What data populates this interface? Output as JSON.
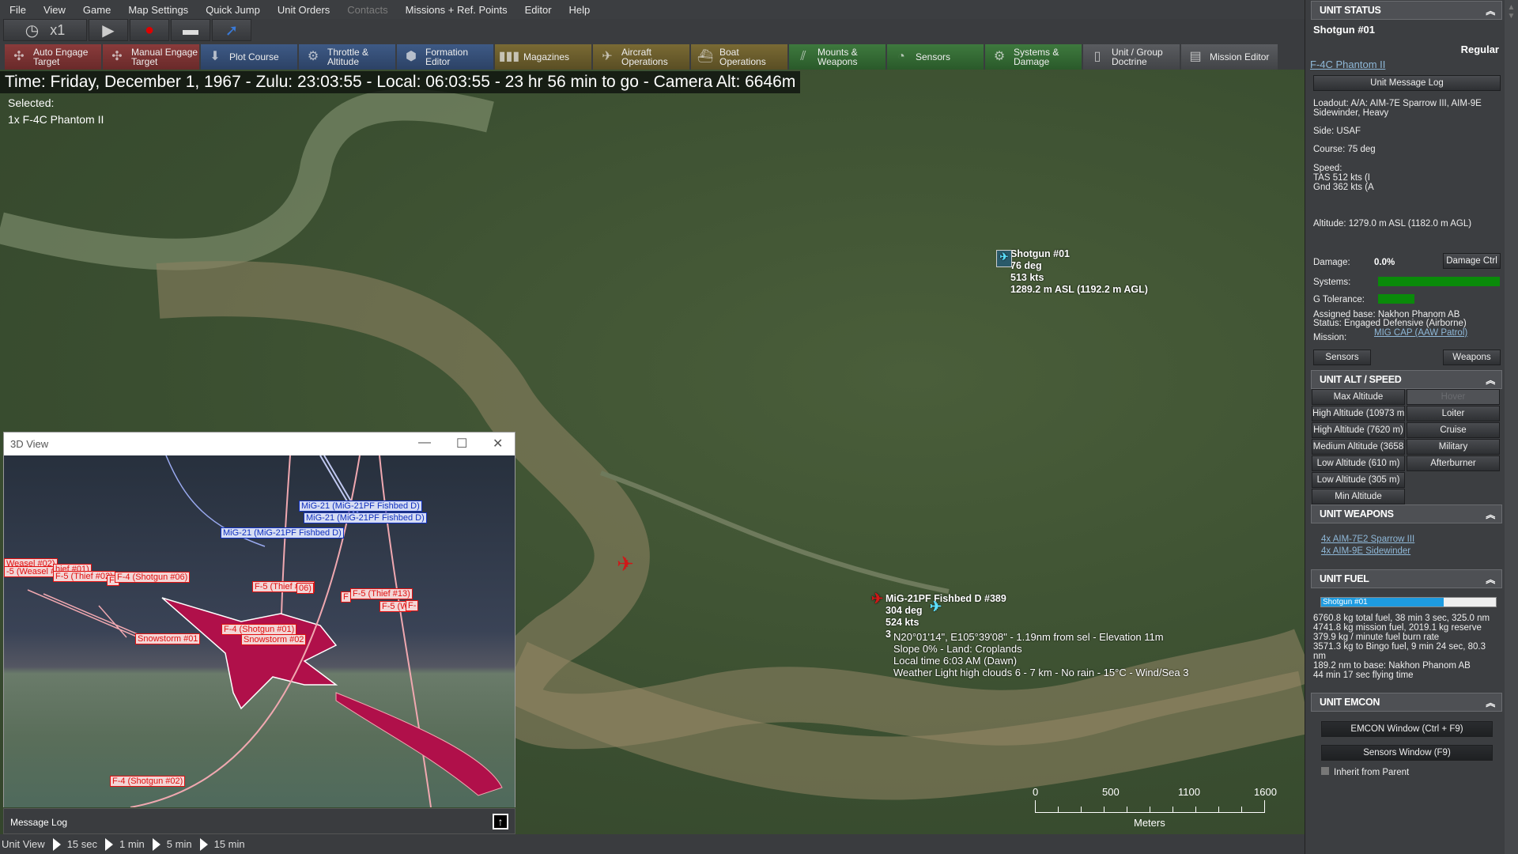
{
  "menu": [
    "File",
    "View",
    "Game",
    "Map Settings",
    "Quick Jump",
    "Unit Orders",
    "Contacts",
    "Missions + Ref. Points",
    "Editor",
    "Help"
  ],
  "menu_disabled": "Contacts",
  "time_control": {
    "speed": "x1"
  },
  "toolbar": [
    {
      "label": "Auto Engage Target",
      "color": "red",
      "icon": "crosshair-arrows-icon"
    },
    {
      "label": "Manual Engage Target",
      "color": "red",
      "icon": "crosshair-arrows-icon"
    },
    {
      "label": "Plot Course",
      "color": "blue",
      "icon": "course-icon"
    },
    {
      "label": "Throttle & Altitude",
      "color": "blue",
      "icon": "throttle-icon"
    },
    {
      "label": "Formation Editor",
      "color": "blue",
      "icon": "formation-icon"
    },
    {
      "label": "Magazines",
      "color": "olive",
      "icon": "ammo-icon"
    },
    {
      "label": "Aircraft Operations",
      "color": "olive",
      "icon": "aircraft-icon"
    },
    {
      "label": "Boat Operations",
      "color": "olive",
      "icon": "boat-icon"
    },
    {
      "label": "Mounts & Weapons",
      "color": "green",
      "icon": "weapons-icon"
    },
    {
      "label": "Sensors",
      "color": "green",
      "icon": "radar-icon"
    },
    {
      "label": "Systems & Damage",
      "color": "green",
      "icon": "gear-icon"
    },
    {
      "label": "Unit / Group Doctrine",
      "color": "gray",
      "icon": "doctrine-icon"
    },
    {
      "label": "Mission Editor",
      "color": "gray",
      "icon": "mission-icon"
    }
  ],
  "timebar": "Time: Friday, December 1, 1967 - Zulu: 23:03:55 - Local: 06:03:55 - 23 hr 56 min to go -  Camera Alt: 6646m",
  "selected": {
    "label": "Selected:",
    "value": "1x F-4C Phantom II"
  },
  "map": {
    "unit": {
      "name": "Shotgun #01",
      "course": "76 deg",
      "speed": "513 kts",
      "alt": "1289.2 m ASL (1192.2 m AGL)"
    },
    "contact": {
      "name": "MiG-21PF Fishbed D #389",
      "course": "304 deg",
      "speed": "524 kts",
      "alt": "3"
    },
    "cursor_info": [
      "N20°01'14\", E105°39'08\" - 1.19nm from sel - Elevation 11m",
      "Slope 0%  - Land: Croplands",
      "Local time 6:03 AM (Dawn)",
      "Weather Light high clouds 6 - 7 km - No rain - 15°C - Wind/Sea 3"
    ],
    "scale": {
      "ticks": [
        "0",
        "500",
        "1100",
        "1600"
      ],
      "unit": "Meters"
    }
  },
  "view3d": {
    "title": "3D View",
    "labels_blue": [
      "MiG-21 (MiG-21PF Fishbed D)",
      "MiG-21 (MiG-21PF Fishbed D)",
      "MiG-21 (MiG-21PF Fishbed D)"
    ],
    "labels_red": [
      "Weasel #02)",
      "-5 (Weasel #01)",
      "hief #01)",
      "F-5 (Thief #02)",
      "F-",
      "F-4 (Shotgun #06)",
      "F-5 (Thief #05)",
      "06)",
      "F",
      "F-5 (Thief #13)",
      "F-5 (W",
      "F-",
      "F-4 (Shotgun #01)",
      "Snowstorm #01",
      "Snowstorm #02",
      "F-4 (Shotgun #02)"
    ]
  },
  "message_log": "Message Log",
  "bottom": {
    "label": "Unit View",
    "steps": [
      "15 sec",
      "1 min",
      "5 min",
      "15 min"
    ]
  },
  "panel": {
    "status": {
      "header": "UNIT STATUS",
      "name": "Shotgun #01",
      "proficiency": "Regular",
      "type": "F-4C Phantom II",
      "msglog_btn": "Unit Message Log",
      "loadout": "Loadout: A/A: AIM-7E Sparrow III, AIM-9E Sidewinder, Heavy",
      "side": "Side: USAF",
      "course": "Course: 75 deg",
      "speed_label": "Speed:",
      "tas": "TAS 512 kts (I",
      "gnd": "Gnd 362 kts (A",
      "altitude": "Altitude: 1279.0 m ASL (1182.0 m AGL)",
      "damage_label": "Damage:",
      "damage": "0.0%",
      "damage_btn": "Damage Ctrl",
      "systems_label": "Systems:",
      "systems_pct": 100,
      "g_label": "G Tolerance:",
      "g_pct": 30,
      "base": "Assigned base: Nakhon Phanom AB",
      "status": "Status: Engaged Defensive (Airborne)",
      "mission_label": "Mission:",
      "mission": "MIG CAP (AAW Patrol)",
      "sensors_btn": "Sensors",
      "weapons_btn": "Weapons",
      "bar_color": "#0a8a0a"
    },
    "altspeed": {
      "header": "UNIT ALT / SPEED",
      "alt": [
        "Max Altitude",
        "High Altitude (10973 m",
        "High Altitude (7620 m)",
        "Medium Altitude (3658",
        "Low Altitude (610 m)",
        "Low Altitude (305 m)",
        "Min Altitude"
      ],
      "speed": [
        "Hover",
        "Loiter",
        "Cruise",
        "Military",
        "Afterburner"
      ]
    },
    "weapons": {
      "header": "UNIT WEAPONS",
      "items": [
        "4x AIM-7E2 Sparrow III",
        "4x AIM-9E Sidewinder"
      ]
    },
    "fuel": {
      "header": "UNIT FUEL",
      "bar_label": "Shotgun #01",
      "fuel_pct": 70,
      "bar_color": "#1e9be0",
      "lines": [
        "6760.8 kg total fuel, 38 min 3 sec, 325.0 nm",
        "4741.8 kg mission fuel, 2019.1 kg reserve",
        "379.9 kg / minute fuel burn rate",
        "3571.3 kg to Bingo fuel, 9 min 24 sec, 80.3 nm",
        "189.2 nm to base: Nakhon Phanom AB",
        "44 min 17 sec flying time"
      ]
    },
    "emcon": {
      "header": "UNIT EMCON",
      "emcon_btn": "EMCON Window (Ctrl + F9)",
      "sensors_btn": "Sensors Window (F9)",
      "inherit": "Inherit from Parent"
    }
  }
}
